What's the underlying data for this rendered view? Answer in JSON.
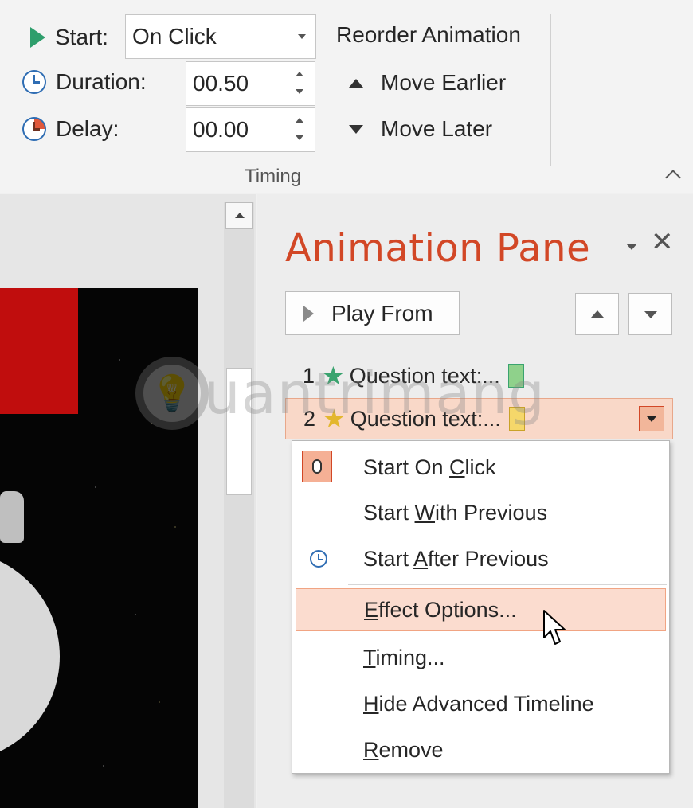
{
  "ribbon": {
    "start_label": "Start:",
    "start_value": "On Click",
    "duration_label": "Duration:",
    "duration_value": "00.50",
    "delay_label": "Delay:",
    "delay_value": "00.00",
    "reorder_title": "Reorder Animation",
    "move_earlier": "Move Earlier",
    "move_later": "Move Later",
    "group_label": "Timing"
  },
  "pane": {
    "title": "Animation Pane",
    "close_glyph": "✕",
    "play_from": "Play From",
    "items": [
      {
        "number": "1",
        "label": "Question text:...",
        "star_color": "#3aa36f",
        "bar_color": "#8fd18b"
      },
      {
        "number": "2",
        "label": "Question text:...",
        "star_color": "#e3b72e",
        "bar_color": "#f5d76a"
      }
    ]
  },
  "menu": {
    "items": [
      {
        "pre": "Start On ",
        "key": "C",
        "post": "lick",
        "icon": "mouse-click-icon"
      },
      {
        "pre": "Start ",
        "key": "W",
        "post": "ith Previous",
        "icon": ""
      },
      {
        "pre": "Start ",
        "key": "A",
        "post": "fter Previous",
        "icon": "clock-icon"
      },
      {
        "pre": "",
        "key": "E",
        "post": "ffect Options...",
        "icon": ""
      },
      {
        "pre": "",
        "key": "T",
        "post": "iming...",
        "icon": ""
      },
      {
        "pre": "",
        "key": "H",
        "post": "ide Advanced Timeline",
        "icon": ""
      },
      {
        "pre": "",
        "key": "R",
        "post": "emove",
        "icon": ""
      }
    ]
  },
  "watermark": {
    "text": "uantrimang",
    "logo": "lightbulb-icon"
  },
  "colors": {
    "accent": "#d24726",
    "highlight": "#fbdccf",
    "start_icon": "#2e9e6c",
    "clock_icon": "#2f6db3"
  }
}
